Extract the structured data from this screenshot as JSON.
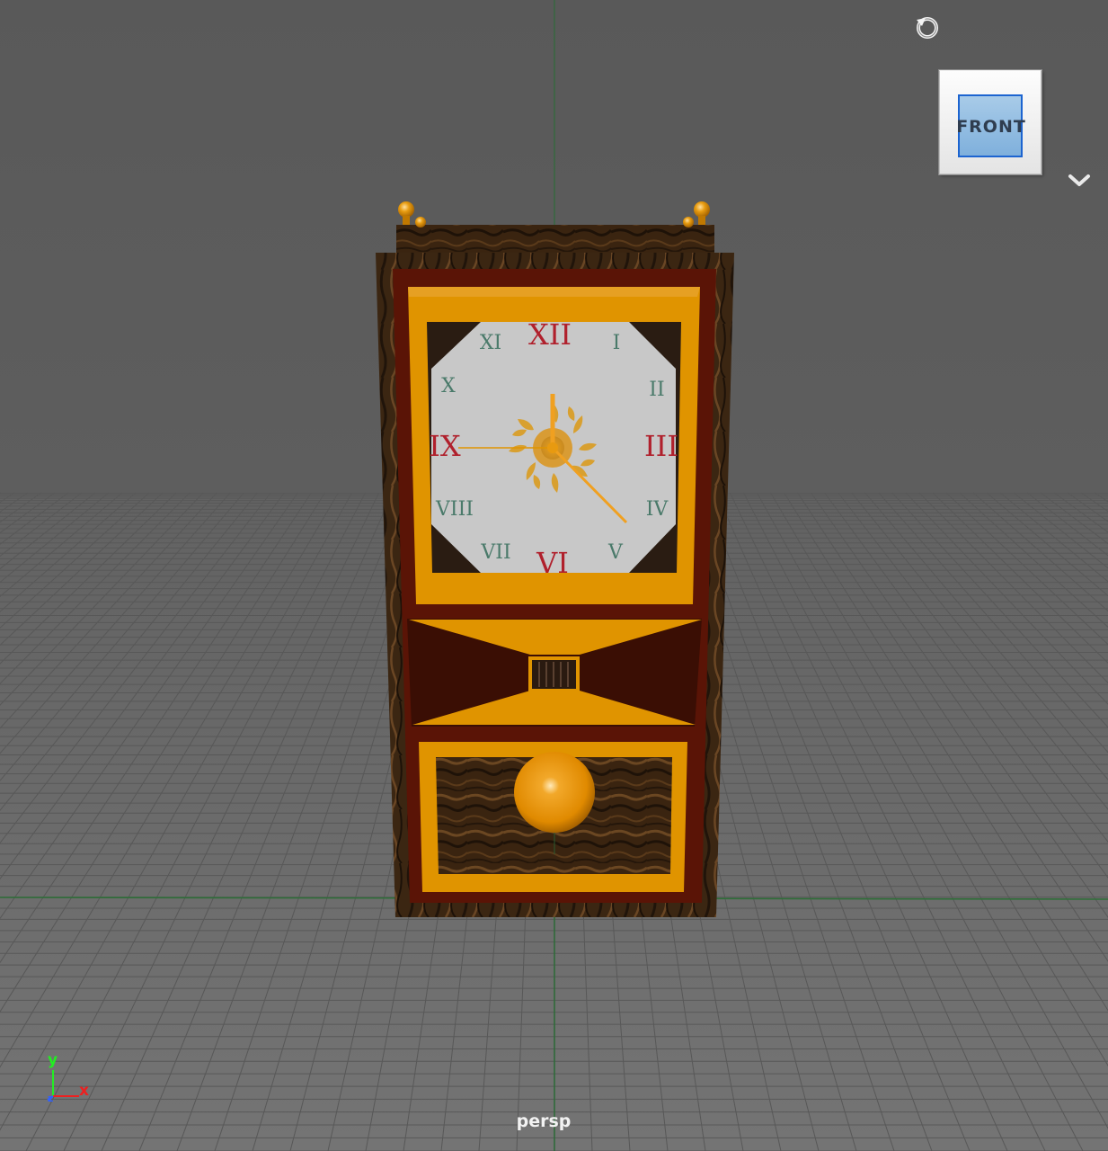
{
  "viewport": {
    "camera_label": "persp",
    "view_cube": {
      "face_label": "FRONT",
      "face_color": "#8fbce3",
      "outline_color": "#1c64d0"
    },
    "icons": {
      "orbit": "orbit-icon",
      "menu": "chevron-down-icon"
    }
  },
  "axis_gizmo": {
    "y_label": "y",
    "x_label": "x",
    "z_label": "z",
    "y_color": "#22ee22",
    "x_color": "#ee2020",
    "z_color": "#3060ff"
  },
  "clock": {
    "numerals": {
      "xii": "XII",
      "i": "I",
      "ii": "II",
      "iii": "III",
      "iv": "IV",
      "v": "V",
      "vi": "VI",
      "vii": "VII",
      "viii": "VIII",
      "ix": "IX",
      "x": "X",
      "xi": "XI"
    },
    "major_color": "#b0202c",
    "minor_color": "#4a7a6a",
    "frame_color": "#e09400",
    "case_color": "#4a0e04"
  }
}
